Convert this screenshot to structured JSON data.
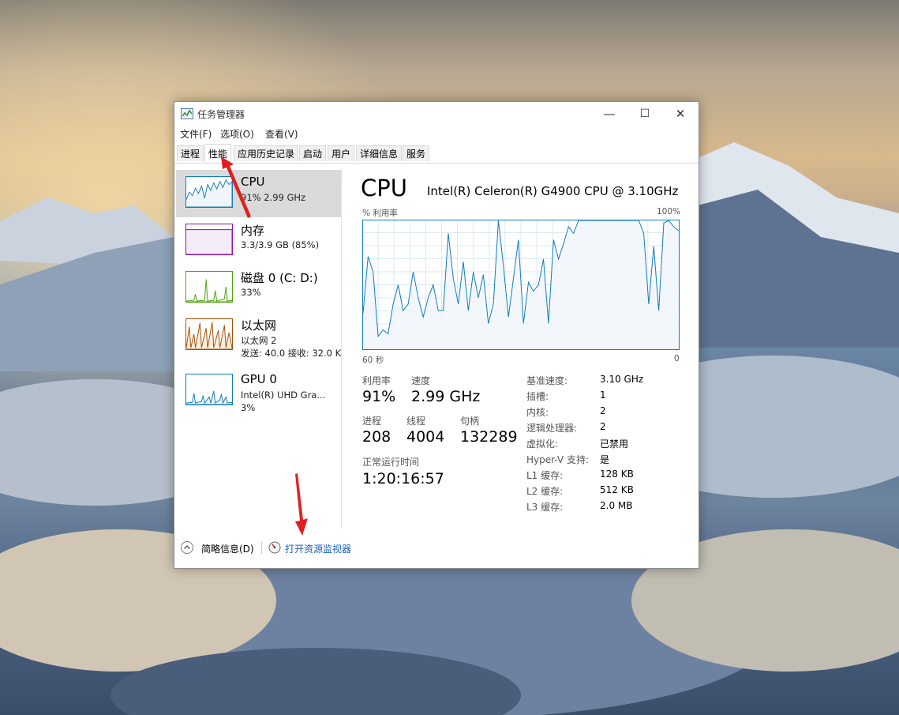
{
  "window": {
    "title": "任务管理器",
    "controls": {
      "minimize": "—",
      "maximize": "☐",
      "close": "✕"
    }
  },
  "menu": {
    "file": "文件(F)",
    "options": "选项(O)",
    "view": "查看(V)"
  },
  "tabs": [
    "进程",
    "性能",
    "应用历史记录",
    "启动",
    "用户",
    "详细信息",
    "服务"
  ],
  "active_tab": "性能",
  "sidebar": {
    "cpu": {
      "name": "CPU",
      "line1": "91% 2.99 GHz",
      "color": "#117dbb"
    },
    "memory": {
      "name": "内存",
      "line1": "3.3/3.9 GB (85%)",
      "color": "#8b12ae"
    },
    "disk": {
      "name": "磁盘 0 (C: D:)",
      "line1": "33%",
      "color": "#4da60c"
    },
    "ethernet": {
      "name": "以太网",
      "line1": "以太网 2",
      "line2": "发送: 40.0  接收: 32.0 K",
      "color": "#a74f01"
    },
    "gpu": {
      "name": "GPU 0",
      "line1": "Intel(R) UHD Gra...",
      "line2": "3%",
      "color": "#117dbb"
    }
  },
  "main": {
    "title": "CPU",
    "model": "Intel(R) Celeron(R) G4900 CPU @ 3.10GHz",
    "graph_label": "% 利用率",
    "graph_max": "100%",
    "axis_left": "60 秒",
    "axis_right": "0",
    "cpu_history_percent": [
      28,
      72,
      60,
      10,
      15,
      12,
      35,
      50,
      30,
      35,
      60,
      40,
      25,
      40,
      50,
      30,
      30,
      90,
      55,
      35,
      68,
      30,
      60,
      40,
      58,
      20,
      35,
      100,
      65,
      25,
      55,
      85,
      20,
      52,
      45,
      50,
      70,
      20,
      85,
      70,
      82,
      95,
      90,
      100,
      100,
      100,
      100,
      100,
      100,
      100,
      100,
      100,
      100,
      100,
      100,
      100,
      90,
      35,
      80,
      30,
      98,
      100,
      95,
      92
    ],
    "stats": {
      "utilization_label": "利用率",
      "utilization": "91%",
      "speed_label": "速度",
      "speed": "2.99 GHz",
      "processes_label": "进程",
      "processes": "208",
      "threads_label": "线程",
      "threads": "4004",
      "handles_label": "句柄",
      "handles": "132289",
      "uptime_label": "正常运行时间",
      "uptime": "1:20:16:57"
    },
    "specs": [
      {
        "k": "基准速度:",
        "v": "3.10 GHz"
      },
      {
        "k": "插槽:",
        "v": "1"
      },
      {
        "k": "内核:",
        "v": "2"
      },
      {
        "k": "逻辑处理器:",
        "v": "2"
      },
      {
        "k": "虚拟化:",
        "v": "已禁用"
      },
      {
        "k": "Hyper-V 支持:",
        "v": "是"
      },
      {
        "k": "L1 缓存:",
        "v": "128 KB"
      },
      {
        "k": "L2 缓存:",
        "v": "512 KB"
      },
      {
        "k": "L3 缓存:",
        "v": "2.0 MB"
      }
    ]
  },
  "footer": {
    "fewer_details": "简略信息(D)",
    "resource_monitor": "打开资源监视器"
  },
  "colors": {
    "cpu_line": "#117dbb",
    "cpu_fill": "#f1f6fa",
    "grid": "#d9eaf4",
    "annotation_arrow": "#e02020",
    "link": "#1a5fb4"
  }
}
